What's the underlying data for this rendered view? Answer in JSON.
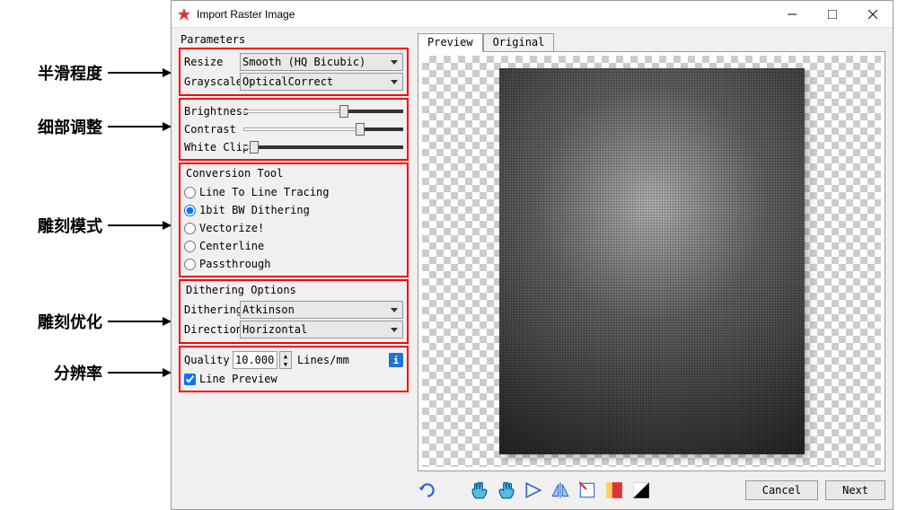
{
  "annotations": {
    "smooth": "半滑程度",
    "detail": "细部调整",
    "mode": "雕刻模式",
    "optimize": "雕刻优化",
    "resolution": "分辨率"
  },
  "window": {
    "title": "Import Raster Image"
  },
  "params_heading": "Parameters",
  "resize": {
    "label": "Resize",
    "value": "Smooth (HQ Bicubic)"
  },
  "grayscale": {
    "label": "Grayscale",
    "value": "OpticalCorrect"
  },
  "brightness": {
    "label": "Brightness"
  },
  "contrast": {
    "label": "Contrast"
  },
  "whiteclip": {
    "label": "White Clip"
  },
  "conversion": {
    "heading": "Conversion Tool",
    "line_tracing": "Line To Line Tracing",
    "dithering": "1bit BW Dithering",
    "vectorize": "Vectorize!",
    "centerline": "Centerline",
    "passthrough": "Passthrough",
    "selected": "1bit BW Dithering"
  },
  "dither_options": {
    "heading": "Dithering Options",
    "dithering_label": "Dithering",
    "dithering_value": "Atkinson",
    "direction_label": "Direction",
    "direction_value": "Horizontal",
    "quality_label": "Quality",
    "quality_value": "10.000",
    "quality_unit": "Lines/mm",
    "line_preview": "Line Preview"
  },
  "tabs": {
    "preview": "Preview",
    "original": "Original"
  },
  "buttons": {
    "cancel": "Cancel",
    "next": "Next"
  },
  "colors": {
    "highlight": "#ff0000"
  }
}
